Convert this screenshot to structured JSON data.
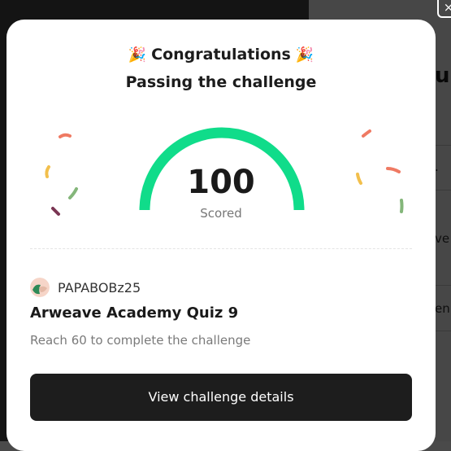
{
  "modal": {
    "title": "Congratulations",
    "party_glyph": "🎉",
    "subtitle": "Passing the challenge",
    "score": {
      "value": "100",
      "label": "Scored",
      "fraction": 1.0,
      "gauge_color": "#10DC8A"
    },
    "user": {
      "name": "PAPABOBz25"
    },
    "quiz_title": "Arweave Academy Quiz 9",
    "hint": "Reach 60 to complete the challenge",
    "cta_label": "View challenge details"
  },
  "background": {
    "heading_fragment": "up",
    "row_fragments": [
      ".",
      "ve",
      "en"
    ]
  },
  "close_button": {
    "glyph": "×"
  }
}
